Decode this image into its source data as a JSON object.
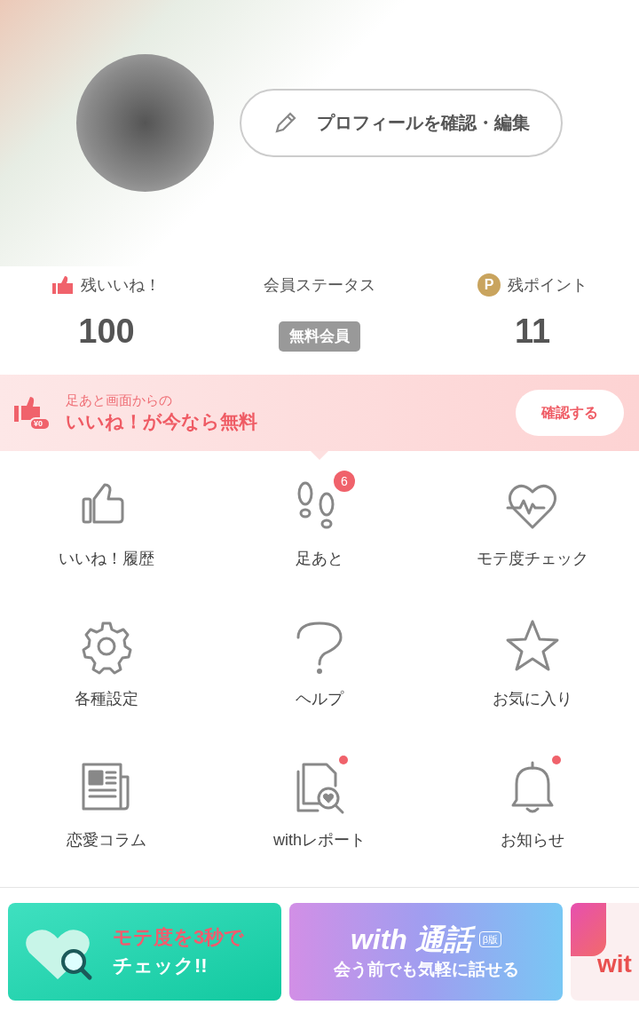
{
  "profile": {
    "edit_button": "プロフィールを確認・編集"
  },
  "stats": [
    {
      "kind": "likes",
      "label": "残いいね！",
      "value": "100"
    },
    {
      "kind": "status",
      "label": "会員ステータス",
      "value": "無料会員"
    },
    {
      "kind": "points",
      "label": "残ポイント",
      "icon_text": "P",
      "value": "11"
    }
  ],
  "promo": {
    "icon_text": "¥0",
    "subtitle": "足あと画面からの",
    "title": "いいね！が今なら無料",
    "button": "確認する"
  },
  "menu": [
    {
      "kind": "thumb",
      "label": "いいね！履歴",
      "dot": false
    },
    {
      "kind": "footprints",
      "label": "足あと",
      "dot": false
    },
    {
      "kind": "heartbeat",
      "label": "モテ度チェック",
      "dot": false
    },
    {
      "kind": "gear",
      "label": "各種設定",
      "dot": false
    },
    {
      "kind": "question",
      "label": "ヘルプ",
      "dot": false
    },
    {
      "kind": "star",
      "label": "お気に入り",
      "dot": false
    },
    {
      "kind": "newspaper",
      "label": "恋愛コラム",
      "dot": false
    },
    {
      "kind": "report",
      "label": "withレポート",
      "dot": true
    },
    {
      "kind": "bell",
      "label": "お知らせ",
      "dot": true
    }
  ],
  "new_footprints_count": "6",
  "banners": [
    {
      "kind": "green",
      "lines": [
        "モテ度を3秒で",
        "チェック!!"
      ]
    },
    {
      "kind": "purple",
      "title": "with 通話",
      "tag": "β版",
      "lines": [
        "会う前でも気軽に話せる"
      ]
    },
    {
      "kind": "red",
      "lines": [
        "wit"
      ]
    }
  ]
}
